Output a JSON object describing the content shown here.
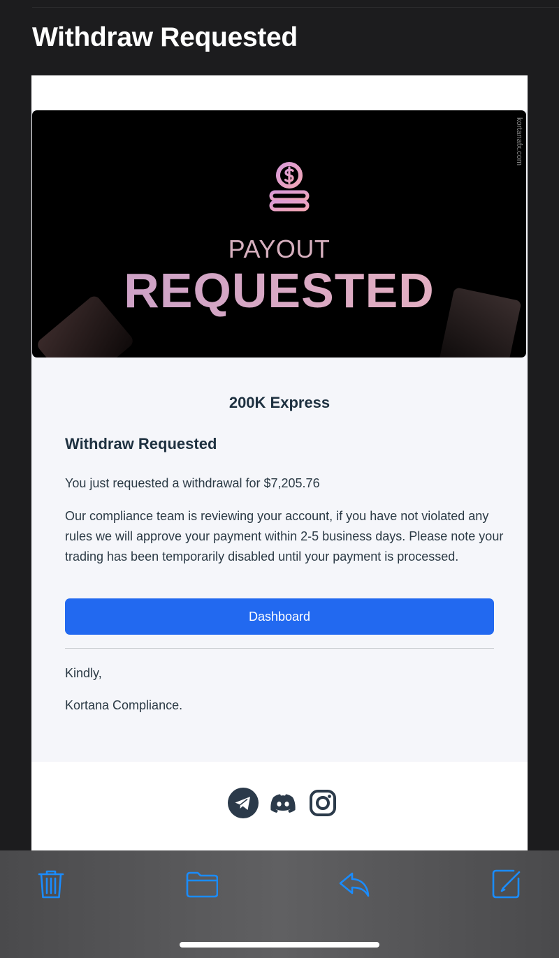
{
  "mail": {
    "subject": "Withdraw Requested"
  },
  "banner": {
    "watermark": "kortanafx.com",
    "line1": "PAYOUT",
    "line2": "REQUESTED",
    "icon": "coin-stack-icon",
    "gradient_colors": [
      "#c79ec8",
      "#e9b2c0"
    ]
  },
  "content": {
    "product": "200K Express",
    "title": "Withdraw Requested",
    "amount_text": "You just requested a withdrawal for $7,205.76",
    "review_text": "Our compliance team is reviewing your account, if you have not violated any rules we will approve your payment within 2-5 business days. Please note your trading has been temporarily disabled until your payment is processed.",
    "button_label": "Dashboard",
    "closing": "Kindly,",
    "signature": "Kortana Compliance."
  },
  "footer": {
    "social_icons": [
      "telegram-icon",
      "discord-icon",
      "instagram-icon"
    ]
  },
  "toolbar": {
    "icons": [
      "trash-icon",
      "folder-icon",
      "reply-icon",
      "compose-icon"
    ],
    "accent": "#1a8cff"
  },
  "colors": {
    "button": "#2269f0",
    "heading": "#1e3140",
    "background": "#1c1c1e"
  }
}
